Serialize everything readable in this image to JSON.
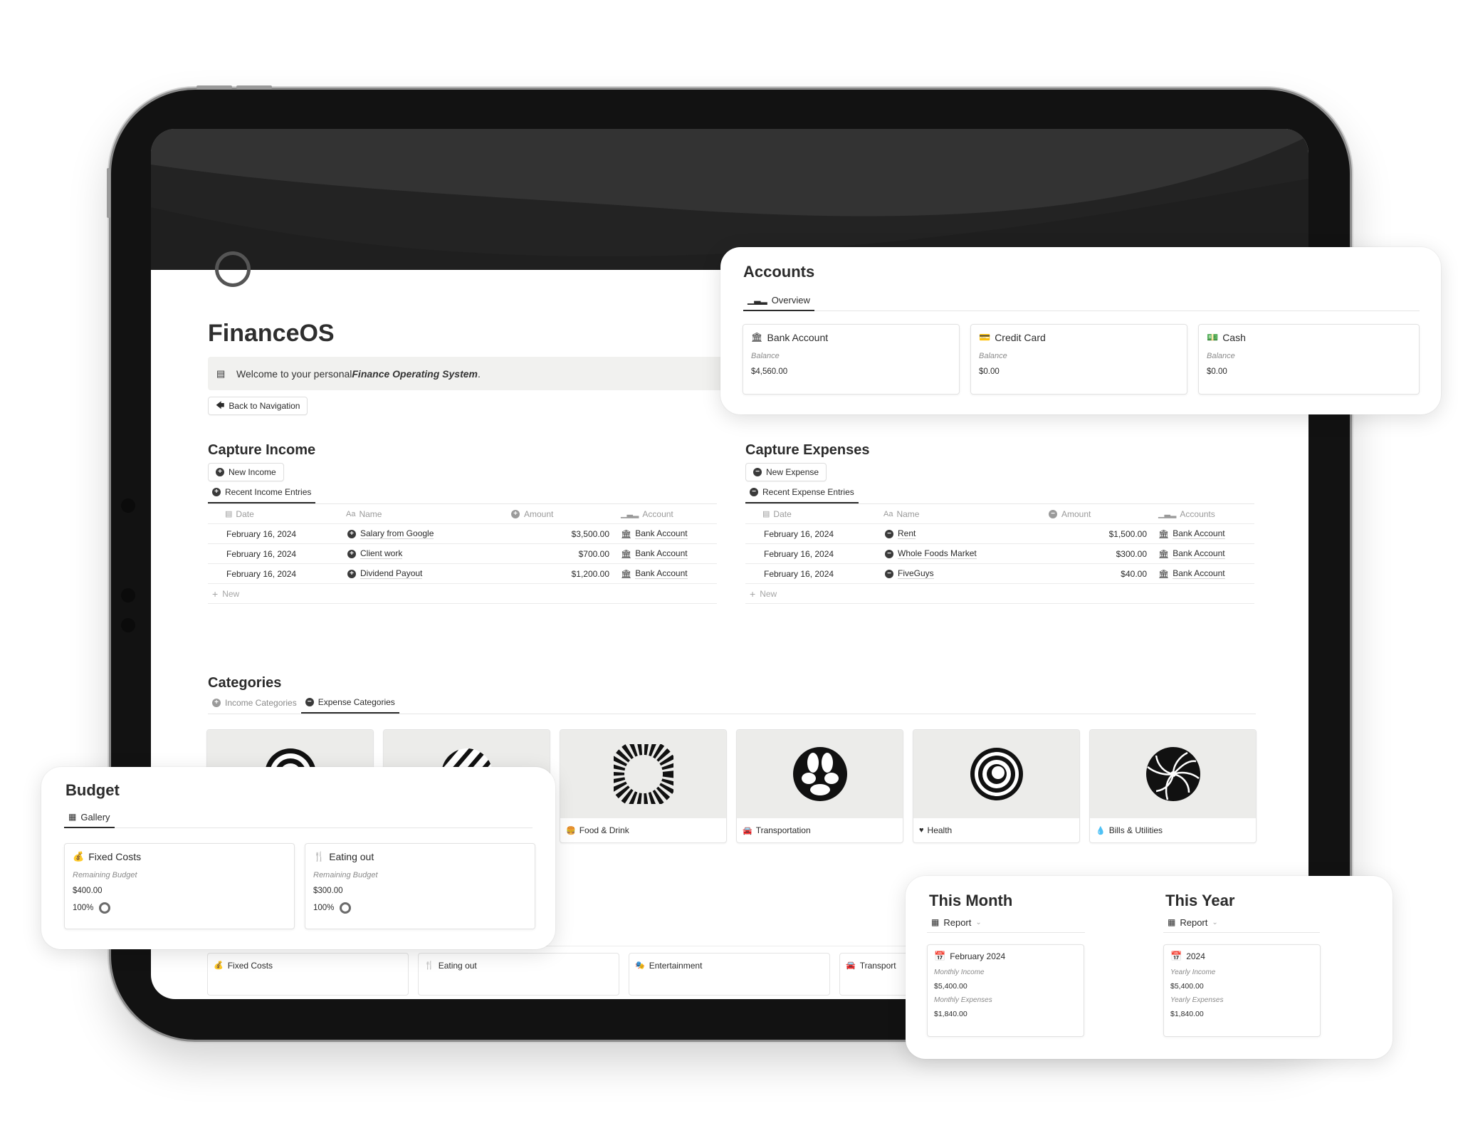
{
  "page": {
    "title": "FinanceOS",
    "icon": "circle-outline-icon",
    "callout": {
      "icon": "cash-register-icon",
      "text_prefix": "Welcome to your personal ",
      "text_emphasis": "Finance Operating System",
      "text_suffix": "."
    },
    "back_button": {
      "icon": "arrow-left-icon",
      "label": "Back to Navigation"
    }
  },
  "income": {
    "title": "Capture Income",
    "new_button": "New Income",
    "view_tab": "Recent Income Entries",
    "columns": [
      "Date",
      "Name",
      "Amount",
      "Account"
    ],
    "rows": [
      {
        "date": "February 16, 2024",
        "name": "Salary from Google",
        "amount": "$3,500.00",
        "account": "Bank Account"
      },
      {
        "date": "February 16, 2024",
        "name": "Client work",
        "amount": "$700.00",
        "account": "Bank Account"
      },
      {
        "date": "February 16, 2024",
        "name": "Dividend Payout",
        "amount": "$1,200.00",
        "account": "Bank Account"
      }
    ],
    "new_row_label": "New"
  },
  "expenses": {
    "title": "Capture Expenses",
    "new_button": "New Expense",
    "view_tab": "Recent Expense Entries",
    "columns": [
      "Date",
      "Name",
      "Amount",
      "Accounts"
    ],
    "rows": [
      {
        "date": "February 16, 2024",
        "name": "Rent",
        "amount": "$1,500.00",
        "account": "Bank Account"
      },
      {
        "date": "February 16, 2024",
        "name": "Whole Foods Market",
        "amount": "$300.00",
        "account": "Bank Account"
      },
      {
        "date": "February 16, 2024",
        "name": "FiveGuys",
        "amount": "$40.00",
        "account": "Bank Account"
      }
    ],
    "new_row_label": "New"
  },
  "categories": {
    "title": "Categories",
    "tabs": [
      {
        "label": "Income Categories",
        "active": false
      },
      {
        "label": "Expense Categories",
        "active": true
      }
    ],
    "cards": [
      {
        "label": "",
        "icon": ""
      },
      {
        "label": "",
        "icon": ""
      },
      {
        "label": "Food & Drink",
        "icon": "food-drink-icon"
      },
      {
        "label": "Transportation",
        "icon": "car-icon"
      },
      {
        "label": "Health",
        "icon": "heart-pulse-icon"
      },
      {
        "label": "Bills & Utilities",
        "icon": "droplet-icon"
      }
    ]
  },
  "budget_strip": {
    "cards": [
      {
        "label": "Fixed Costs",
        "icon": "money-bag-icon"
      },
      {
        "label": "Eating out",
        "icon": "utensils-icon"
      },
      {
        "label": "Entertainment",
        "icon": "mask-icon"
      },
      {
        "label": "Transport",
        "icon": "car-icon"
      }
    ]
  },
  "accounts_panel": {
    "title": "Accounts",
    "tab": "Overview",
    "cards": [
      {
        "name": "Bank Account",
        "icon": "bank-icon",
        "label": "Balance",
        "value": "$4,560.00"
      },
      {
        "name": "Credit Card",
        "icon": "credit-card-icon",
        "label": "Balance",
        "value": "$0.00"
      },
      {
        "name": "Cash",
        "icon": "cash-icon",
        "label": "Balance",
        "value": "$0.00"
      }
    ]
  },
  "budget_panel": {
    "title": "Budget",
    "tab": "Gallery",
    "cards": [
      {
        "name": "Fixed Costs",
        "icon": "money-bag-icon",
        "label": "Remaining Budget",
        "value": "$400.00",
        "progress": "100%"
      },
      {
        "name": "Eating out",
        "icon": "utensils-icon",
        "label": "Remaining Budget",
        "value": "$300.00",
        "progress": "100%"
      }
    ]
  },
  "month_panel": {
    "title": "This Month",
    "tab": "Report",
    "card": {
      "name": "February 2024",
      "icon": "calendar-icon",
      "income_label": "Monthly Income",
      "income_value": "$5,400.00",
      "expenses_label": "Monthly Expenses",
      "expenses_value": "$1,840.00"
    }
  },
  "year_panel": {
    "title": "This Year",
    "tab": "Report",
    "card": {
      "name": "2024",
      "icon": "calendar-icon",
      "income_label": "Yearly Income",
      "income_value": "$5,400.00",
      "expenses_label": "Yearly Expenses",
      "expenses_value": "$1,840.00"
    }
  },
  "colors": {
    "text": "#2b2b2b",
    "muted": "#8a8a8a",
    "cover": "#232323",
    "device": "#121212",
    "callout_bg": "#f1f1ef"
  }
}
